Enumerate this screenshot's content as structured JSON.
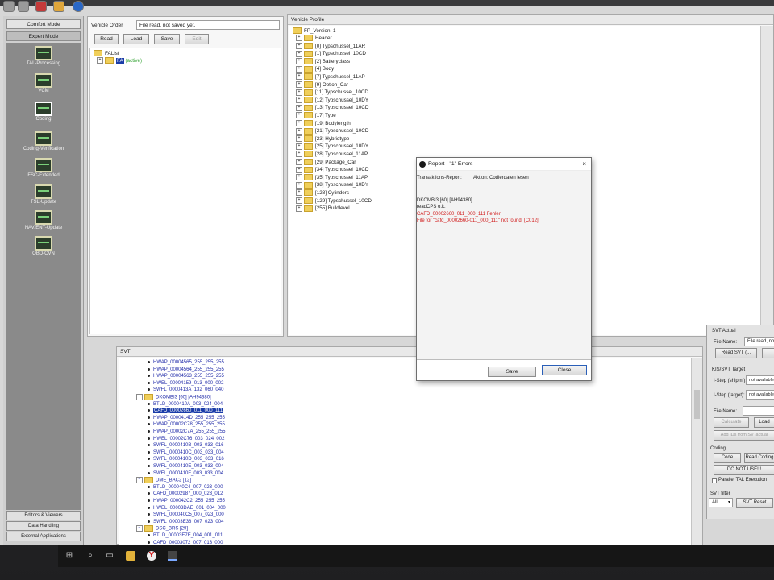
{
  "sidebar": {
    "modes": [
      "Comfort Mode",
      "Expert Mode"
    ],
    "nav_items": [
      "TAL-Processing",
      "VCM",
      "Coding",
      "Coding-Verification",
      "FSC-Extended",
      "TSL-Update",
      "NAV/ENT-Update",
      "OBD-CVN"
    ],
    "footer": [
      "Editors & Viewers",
      "Data Handling",
      "External Applications"
    ]
  },
  "vehicle_order": {
    "label": "Vehicle Order",
    "status": "File read, not saved yet.",
    "buttons": [
      "Read",
      "Load",
      "Save",
      "Edit"
    ],
    "tree_root": "FAList",
    "tree_child": "FA",
    "tree_child_tag": "(active)"
  },
  "vehicle_profile": {
    "title": "Vehicle Profile",
    "root": "FP_Version: 1",
    "items": [
      "Header",
      "[0] Typschussel_11AR",
      "[1] Typschussel_10CD",
      "[2] Batteryclass",
      "[4] Body",
      "[7] Typschussel_11AP",
      "[9] Option_Car",
      "[11] Typschussel_10CD",
      "[12] Typschussel_10DY",
      "[13] Typschussel_10CD",
      "[17] Type",
      "[19] Bodylength",
      "[21] Typschussel_10CD",
      "[23] Hybridtype",
      "[25] Typschussel_10DY",
      "[28] Typschussel_11AP",
      "[29] Package_Car",
      "[34] Typschussel_10CD",
      "[35] Typschussel_11AP",
      "[38] Typschussel_10DY",
      "[128] Cylinders",
      "[129] Typschussel_10CD",
      "[255] Buildlevel"
    ]
  },
  "svt": {
    "title": "SVT",
    "rows": [
      {
        "kind": "leaf",
        "text": "HWAP_00004565_255_255_255"
      },
      {
        "kind": "leaf",
        "text": "HWAP_00004564_255_255_255"
      },
      {
        "kind": "leaf",
        "text": "HWAP_00004563_255_255_255"
      },
      {
        "kind": "leaf",
        "text": "HWEL_00004159_013_000_002"
      },
      {
        "kind": "leaf",
        "text": "SWFL_0000413A_132_060_040"
      },
      {
        "kind": "node",
        "text": "DKOMBI3 [60] [AH94380]"
      },
      {
        "kind": "leaf",
        "text": "BTLD_0000410A_003_024_004"
      },
      {
        "kind": "leaf",
        "text": "CAFD_00002660_011_000_111",
        "selected": true
      },
      {
        "kind": "leaf",
        "text": "HWAP_0000414D_255_255_255"
      },
      {
        "kind": "leaf",
        "text": "HWAP_00002C78_255_255_255"
      },
      {
        "kind": "leaf",
        "text": "HWAP_00002C7A_255_255_255"
      },
      {
        "kind": "leaf",
        "text": "HWEL_00002C76_003_024_002"
      },
      {
        "kind": "leaf",
        "text": "SWFL_0000410B_003_033_016"
      },
      {
        "kind": "leaf",
        "text": "SWFL_0000410C_003_033_004"
      },
      {
        "kind": "leaf",
        "text": "SWFL_0000410D_003_033_016"
      },
      {
        "kind": "leaf",
        "text": "SWFL_0000410E_003_033_004"
      },
      {
        "kind": "leaf",
        "text": "SWFL_0000410F_003_033_004"
      },
      {
        "kind": "node",
        "text": "DME_BAC2 [12]"
      },
      {
        "kind": "leaf",
        "text": "BTLD_000040C4_007_023_000"
      },
      {
        "kind": "leaf",
        "text": "CAFD_00002987_000_023_012"
      },
      {
        "kind": "leaf",
        "text": "HWAP_000042C2_255_255_255"
      },
      {
        "kind": "leaf",
        "text": "HWEL_00003DAE_001_004_000"
      },
      {
        "kind": "leaf",
        "text": "SWFL_000040C5_007_023_000"
      },
      {
        "kind": "leaf",
        "text": "SWFL_00003E38_007_023_004"
      },
      {
        "kind": "node",
        "text": "DSC_BRS [29]"
      },
      {
        "kind": "leaf",
        "text": "BTLD_00003E7E_004_001_011"
      },
      {
        "kind": "leaf",
        "text": "CAFD_00003072_007_013_000"
      }
    ]
  },
  "dialog": {
    "title": "Report - \"1\" Errors",
    "close_glyph": "×",
    "header_left": "Transaktions-Report:",
    "header_right": "Aktion: Codierdaten lesen",
    "line1": "DKOMBI3 [60] [AH94380]",
    "line2": "readCPS o.k.",
    "error1": "CAFD_00002660_011_000_111 Fehler:",
    "error2": "File for \"cafd_00002660-011_000_111\" not found! [C012]",
    "save": "Save",
    "close": "Close"
  },
  "right_pane": {
    "svt_actual": "SVT Actual",
    "file_name_label": "File Name:",
    "file_name_value": "File read, not",
    "read_svt": "Read SVT (...",
    "kis_title": "KIS/SVT Target",
    "istep_shipm": "I-Step (shipm.):",
    "istep_target": "I-Step (target):",
    "not_available": "not available",
    "file_name2": "File Name:",
    "calculate": "Calculate",
    "load": "Load",
    "hw_ids": "Add IDs from SVTactual",
    "coding_title": "Coding",
    "code": "Code",
    "read_coding": "Read Coding",
    "do_not_use": "DO NOT USE!!!",
    "parallel_tal": "Parallel TAL Execution",
    "svt_filter": "SVT filter",
    "filter_value": "All",
    "svt_reset": "SVT Reset"
  },
  "taskbar": {
    "icons": [
      "windows-icon",
      "search-icon",
      "task-view-icon",
      "file-explorer-icon",
      "yandex-icon",
      "app-icon"
    ]
  },
  "colors": {
    "selection": "#1a3ca8",
    "error": "#d01818",
    "folder": "#f0cf5a"
  }
}
